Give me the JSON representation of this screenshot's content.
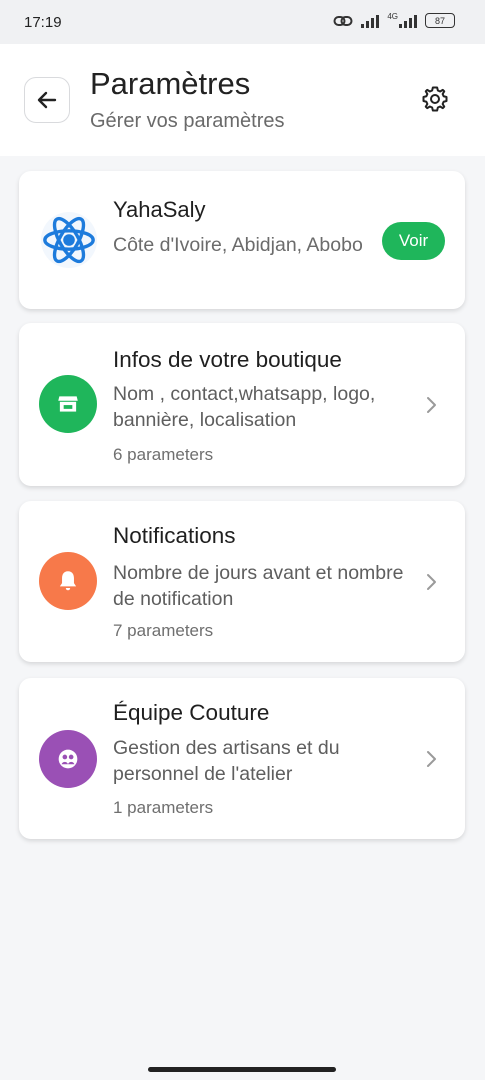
{
  "status_bar": {
    "time": "17:19",
    "network_label": "4G",
    "battery": "87",
    "icons": [
      "link-icon",
      "signal-icon",
      "signal-4g-icon",
      "battery-icon"
    ]
  },
  "header": {
    "title": "Paramètres",
    "subtitle": "Gérer vos paramètres",
    "back_icon": "arrow-left-icon",
    "settings_icon": "gear-icon"
  },
  "profile": {
    "name": "YahaSaly",
    "location": "Côte d'Ivoire, Abidjan, Abobo",
    "view_button": "Voir",
    "logo_icon": "atom-icon"
  },
  "settings": [
    {
      "title": "Infos de votre boutique",
      "description": "Nom , contact,whatsapp, logo, bannière, localisation",
      "count": "6 parameters",
      "icon": "store-icon",
      "color": "#1fb65b"
    },
    {
      "title": "Notifications",
      "description": "Nombre de jours avant et nombre de notification",
      "count": "7 parameters",
      "icon": "bell-icon",
      "color": "#f7794a"
    },
    {
      "title": "Équipe Couture",
      "description": "Gestion des artisans et du personnel de l'atelier",
      "count": "1 parameters",
      "icon": "team-icon",
      "color": "#9a50b5"
    }
  ],
  "colors": {
    "accent_green": "#1fb65b",
    "background": "#f5f6f8",
    "card": "#ffffff"
  }
}
